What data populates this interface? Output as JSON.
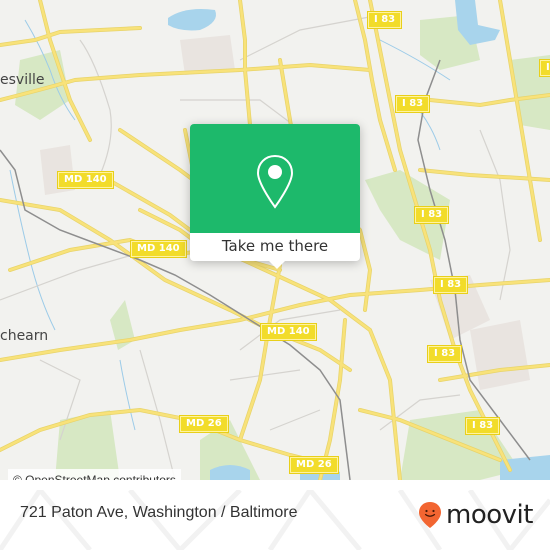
{
  "map": {
    "shields": [
      {
        "id": "i83-top",
        "label": "I 83"
      },
      {
        "id": "i83-topright",
        "label": "I 83"
      },
      {
        "id": "i83-mid1",
        "label": "I 83"
      },
      {
        "id": "i83-mid2",
        "label": "I 83"
      },
      {
        "id": "i83-mid3",
        "label": "I 83"
      },
      {
        "id": "i83-low",
        "label": "I 83"
      },
      {
        "id": "i83-bottom",
        "label": "I 83"
      },
      {
        "id": "md140-left",
        "label": "MD 140"
      },
      {
        "id": "md140-mid",
        "label": "MD 140"
      },
      {
        "id": "md140-center",
        "label": "MD 140"
      },
      {
        "id": "md26-left",
        "label": "MD 26"
      },
      {
        "id": "md26-right",
        "label": "MD 26"
      }
    ],
    "places": [
      {
        "id": "pikesville",
        "label": "esville"
      },
      {
        "id": "milford-mill",
        "label": "chearn"
      }
    ],
    "attribution": "© OpenStreetMap contributors"
  },
  "popup": {
    "icon": "location-pin-icon",
    "button_label": "Take me there",
    "accent_color": "#1db96b"
  },
  "footer": {
    "address": "721 Paton Ave, Washington / Baltimore",
    "brand": "moovit",
    "brand_color": "#f26531"
  }
}
